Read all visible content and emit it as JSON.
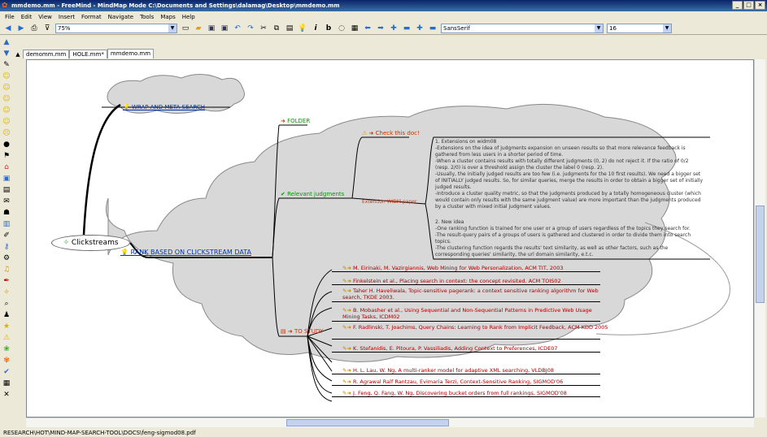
{
  "window": {
    "title": "mmdemo.mm - FreeMind - MindMap Mode C:\\Documents and Settings\\dalamag\\Desktop\\mmdemo.mm",
    "min": "_",
    "max": "□",
    "close": "×"
  },
  "menu": [
    "File",
    "Edit",
    "View",
    "Insert",
    "Format",
    "Navigate",
    "Tools",
    "Maps",
    "Help"
  ],
  "toolbar": {
    "zoom": "75%",
    "font": "SansSerif",
    "font_size": "16"
  },
  "tabs": [
    "demomm.mm",
    "HOLE.mm*",
    "mmdemo.mm"
  ],
  "map": {
    "root": "Clickstreams",
    "wrap": "WRAP AND META-SEARCH",
    "rank": "RANK BASED ON CLICKSTREAM DATA",
    "folder": "FOLDER",
    "relevant": "Relevant judgments",
    "check": "Check this doc!",
    "extention": "Extention WIDM paper",
    "to_study": "TO STUDY",
    "detail1": "1. Extensions on widm08\n-Extensions on the idea of judgments expansion on unseen results so that more relevance feedback is gathered from less users in a shorter period of time.\n-When a cluster contains results with totally different judgments (0, 2) do not reject it. If the ratio of 0/2 (resp. 2/0) is over a threshold assign the cluster the label 0 (resp. 2).\n-Usually, the initially judged results are too few (i.e. judgments for the 10 first results). We need a bigger set of INITIALLY judged results. So, for similar queries, merge the results in order to obtain a bigger set of initially judged results.\n-Introduce a cluster quality metric, so that the judgments produced by a totally homogeneous cluster (which would contain only results with the same judgment value) are more important than the judgments produced by a cluster with mixed initial judgment values.",
    "detail2": "2. New idea\n-One ranking function is trained for one user or a group of users regardless of the topics they search for.\n-The result-query pairs of a groups of users is gathered and clustered in order to divide them into search topics.\n-The clustering function regards the results' text similarity, as well as other factors, such as the corresponding queries' similarity, the url domain similarity, e.t.c.",
    "refs": [
      "M. Eirinaki, M. Vazirgiannis, Web Mining for Web Personalization, ACM TIT, 2003",
      "Finkelstein et al., Placing search in context: the concept revisited. ACM TOIS02",
      "Taher H. Haveliwala, Topic-sensitive pagerank: a context sensitive ranking algorithm for Web search, TKDE 2003.",
      "B. Mobasher et al., Using Sequential and Non-Sequential Patterns in Predictive Web Usage Mining Tasks, ICDM02",
      "F. Radlinski, T. Joachims, Query Chains: Learning to Rank from Implicit Feedback, ACM KDD 2005",
      "K. Stefanidis, E. Pitoura, P. Vassiliadis, Adding Context to Preferences, ICDE07",
      "",
      "H. L. Lau, W. Ng, A multi-ranker model for adaptive XML searching, VLDBJ08",
      "R. Agrawal Ralf Rantzau, Evimaria Terzi, Context-Sensitive Ranking, SIGMOD'06",
      "J. Feng, Q. Fang, W. Ng, Discovering bucket orders from full rankings, SIGMOD'08"
    ]
  },
  "status": "RESEARCH\\HOT\\MIND-MAP-SEARCH-TOOL\\DOCS\\feng-sigmod08.pdf"
}
